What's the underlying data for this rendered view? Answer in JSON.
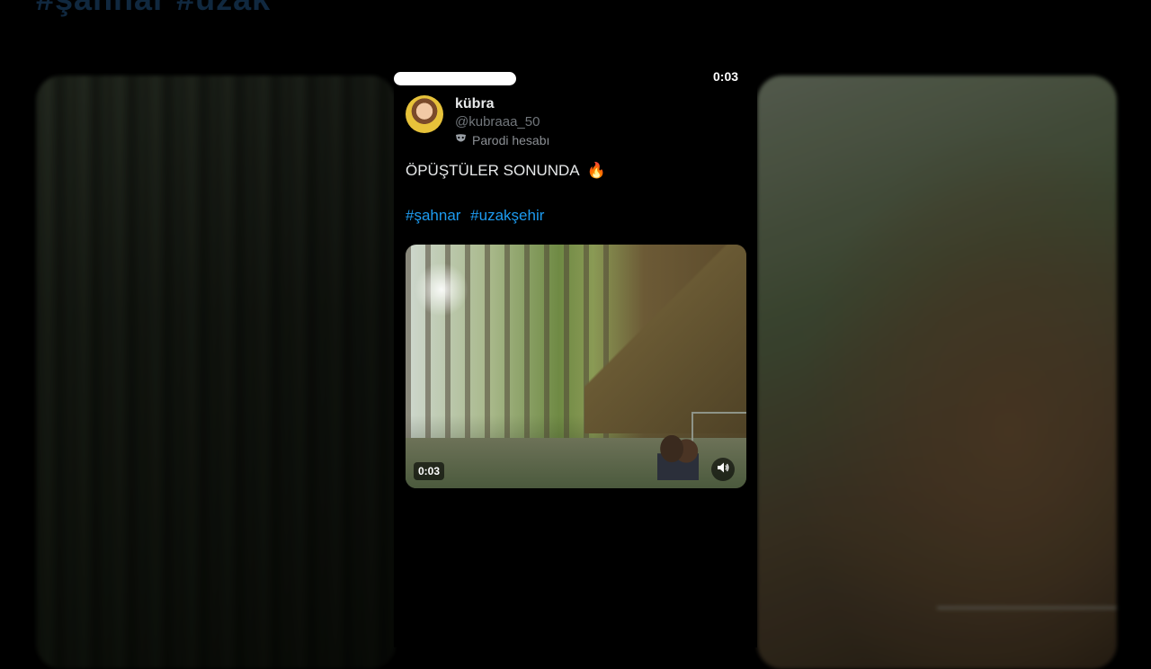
{
  "status": {
    "time": "0:03"
  },
  "tweet": {
    "author_name": "kübra",
    "handle": "@kubraaa_50",
    "account_label": "Parodi hesabı",
    "text": "ÖPÜŞTÜLER SONUNDA",
    "emoji": "🔥",
    "hashtags": [
      "#şahnar",
      "#uzakşehir"
    ]
  },
  "video": {
    "duration": "0:03",
    "sound_icon": "speaker-icon"
  },
  "icons": {
    "parody": "mask-icon",
    "emoji": "fire-icon"
  }
}
